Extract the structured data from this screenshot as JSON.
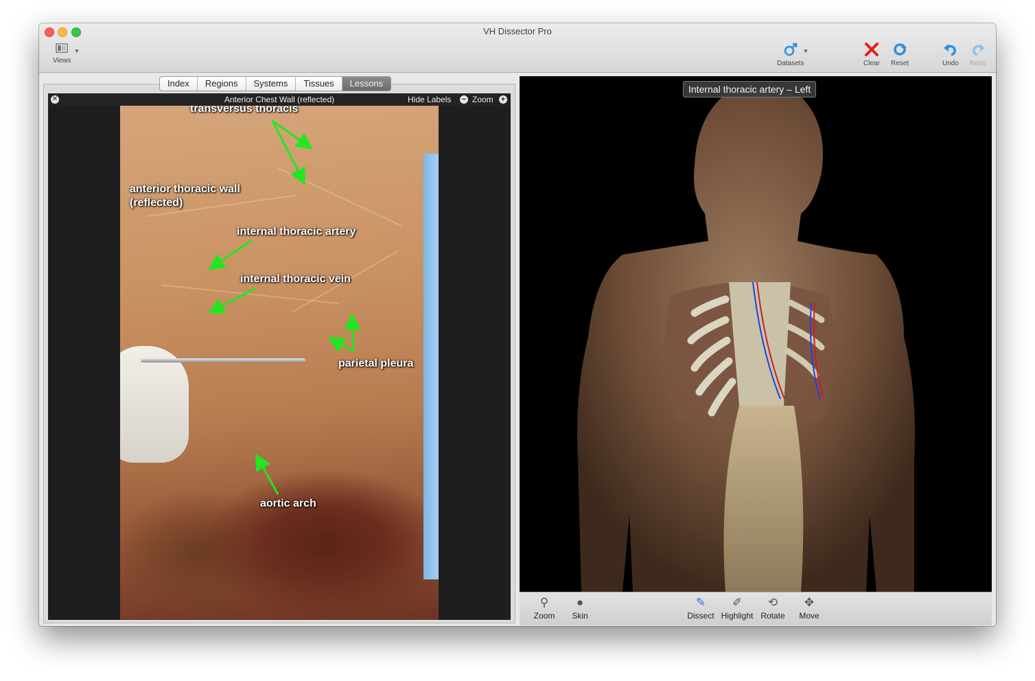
{
  "window": {
    "title": "VH Dissector Pro"
  },
  "toolbar": {
    "views_label": "Views",
    "datasets_label": "Datasets",
    "clear_label": "Clear",
    "reset_label": "Reset",
    "undo_label": "Undo",
    "redo_label": "Redo"
  },
  "tabs": [
    {
      "label": "Index"
    },
    {
      "label": "Regions"
    },
    {
      "label": "Systems"
    },
    {
      "label": "Tissues"
    },
    {
      "label": "Lessons",
      "active": true
    }
  ],
  "lesson": {
    "title": "Anterior Chest Wall (reflected)",
    "hide_labels": "Hide Labels",
    "zoom_label": "Zoom",
    "annotations": {
      "transversus": "transversus thoracis",
      "wall_line1": "anterior thoracic wall",
      "wall_line2": "(reflected)",
      "artery": "internal thoracic artery",
      "vein": "internal thoracic vein",
      "pleura": "parietal pleura",
      "aortic": "aortic arch"
    }
  },
  "viewer": {
    "tooltip": "Internal thoracic artery – Left",
    "tools": {
      "zoom": "Zoom",
      "skin": "Skin",
      "dissect": "Dissect",
      "highlight": "Highlight",
      "rotate": "Rotate",
      "move": "Move"
    }
  },
  "icons": {
    "views": "views-icon",
    "datasets": "male-symbol-icon",
    "clear": "red-x-icon",
    "reset": "reset-arrows-icon",
    "undo": "undo-arrow-icon",
    "redo": "redo-arrow-icon"
  },
  "colors": {
    "annotation_arrow": "#22e622",
    "clear_red": "#e3201b",
    "accent_blue": "#2f8fdc"
  }
}
